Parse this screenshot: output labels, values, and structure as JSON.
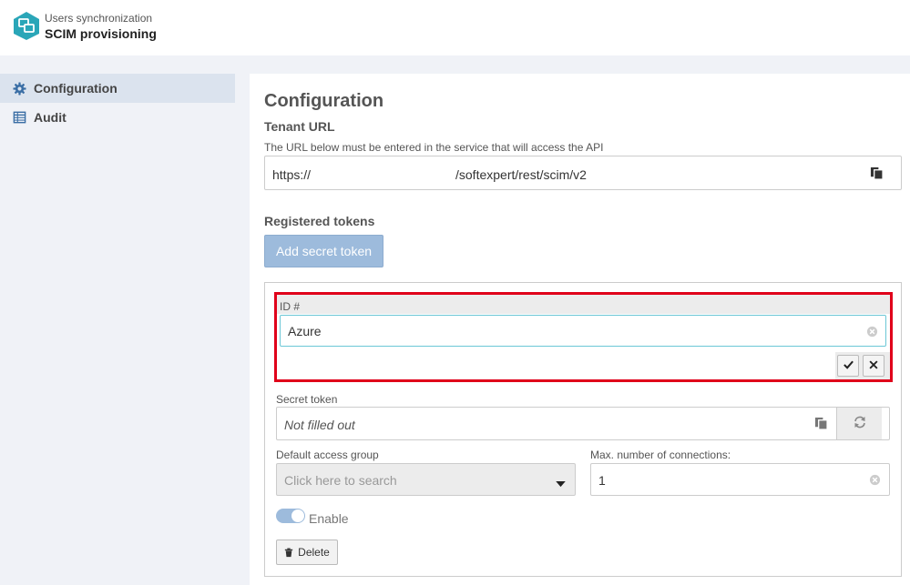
{
  "header": {
    "subtitle": "Users synchronization",
    "title": "SCIM provisioning"
  },
  "sidebar": {
    "items": [
      {
        "label": "Configuration",
        "icon": "gear-icon",
        "active": true
      },
      {
        "label": "Audit",
        "icon": "table-icon",
        "active": false
      }
    ]
  },
  "main": {
    "title": "Configuration",
    "tenant": {
      "heading": "Tenant URL",
      "description": "The URL below must be entered in the service that will access the API",
      "url_prefix": "https://",
      "url_suffix": "/softexpert/rest/scim/v2"
    },
    "tokens": {
      "heading": "Registered tokens",
      "add_label": "Add secret token",
      "card": {
        "id_label": "ID #",
        "id_value": "Azure",
        "secret_label": "Secret token",
        "secret_placeholder": "Not filled out",
        "access_group_label": "Default access group",
        "access_group_placeholder": "Click here to search",
        "max_connections_label": "Max. number of connections:",
        "max_connections_value": "1",
        "enable_label": "Enable",
        "enabled": true,
        "delete_label": "Delete"
      }
    }
  },
  "colors": {
    "accent": "#9dbbdc",
    "highlight_border": "#e0001a",
    "focus_border": "#6cc7d6",
    "logo": "#2aa6b8"
  }
}
